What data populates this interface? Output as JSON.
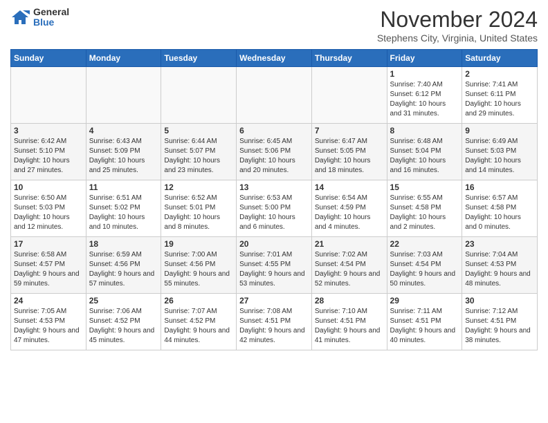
{
  "logo": {
    "general": "General",
    "blue": "Blue"
  },
  "header": {
    "month": "November 2024",
    "location": "Stephens City, Virginia, United States"
  },
  "days_of_week": [
    "Sunday",
    "Monday",
    "Tuesday",
    "Wednesday",
    "Thursday",
    "Friday",
    "Saturday"
  ],
  "weeks": [
    [
      {
        "day": "",
        "empty": true
      },
      {
        "day": "",
        "empty": true
      },
      {
        "day": "",
        "empty": true
      },
      {
        "day": "",
        "empty": true
      },
      {
        "day": "",
        "empty": true
      },
      {
        "day": "1",
        "sunrise": "7:40 AM",
        "sunset": "6:12 PM",
        "daylight": "10 hours and 31 minutes."
      },
      {
        "day": "2",
        "sunrise": "7:41 AM",
        "sunset": "6:11 PM",
        "daylight": "10 hours and 29 minutes."
      }
    ],
    [
      {
        "day": "3",
        "sunrise": "6:42 AM",
        "sunset": "5:10 PM",
        "daylight": "10 hours and 27 minutes."
      },
      {
        "day": "4",
        "sunrise": "6:43 AM",
        "sunset": "5:09 PM",
        "daylight": "10 hours and 25 minutes."
      },
      {
        "day": "5",
        "sunrise": "6:44 AM",
        "sunset": "5:07 PM",
        "daylight": "10 hours and 23 minutes."
      },
      {
        "day": "6",
        "sunrise": "6:45 AM",
        "sunset": "5:06 PM",
        "daylight": "10 hours and 20 minutes."
      },
      {
        "day": "7",
        "sunrise": "6:47 AM",
        "sunset": "5:05 PM",
        "daylight": "10 hours and 18 minutes."
      },
      {
        "day": "8",
        "sunrise": "6:48 AM",
        "sunset": "5:04 PM",
        "daylight": "10 hours and 16 minutes."
      },
      {
        "day": "9",
        "sunrise": "6:49 AM",
        "sunset": "5:03 PM",
        "daylight": "10 hours and 14 minutes."
      }
    ],
    [
      {
        "day": "10",
        "sunrise": "6:50 AM",
        "sunset": "5:03 PM",
        "daylight": "10 hours and 12 minutes."
      },
      {
        "day": "11",
        "sunrise": "6:51 AM",
        "sunset": "5:02 PM",
        "daylight": "10 hours and 10 minutes."
      },
      {
        "day": "12",
        "sunrise": "6:52 AM",
        "sunset": "5:01 PM",
        "daylight": "10 hours and 8 minutes."
      },
      {
        "day": "13",
        "sunrise": "6:53 AM",
        "sunset": "5:00 PM",
        "daylight": "10 hours and 6 minutes."
      },
      {
        "day": "14",
        "sunrise": "6:54 AM",
        "sunset": "4:59 PM",
        "daylight": "10 hours and 4 minutes."
      },
      {
        "day": "15",
        "sunrise": "6:55 AM",
        "sunset": "4:58 PM",
        "daylight": "10 hours and 2 minutes."
      },
      {
        "day": "16",
        "sunrise": "6:57 AM",
        "sunset": "4:58 PM",
        "daylight": "10 hours and 0 minutes."
      }
    ],
    [
      {
        "day": "17",
        "sunrise": "6:58 AM",
        "sunset": "4:57 PM",
        "daylight": "9 hours and 59 minutes."
      },
      {
        "day": "18",
        "sunrise": "6:59 AM",
        "sunset": "4:56 PM",
        "daylight": "9 hours and 57 minutes."
      },
      {
        "day": "19",
        "sunrise": "7:00 AM",
        "sunset": "4:56 PM",
        "daylight": "9 hours and 55 minutes."
      },
      {
        "day": "20",
        "sunrise": "7:01 AM",
        "sunset": "4:55 PM",
        "daylight": "9 hours and 53 minutes."
      },
      {
        "day": "21",
        "sunrise": "7:02 AM",
        "sunset": "4:54 PM",
        "daylight": "9 hours and 52 minutes."
      },
      {
        "day": "22",
        "sunrise": "7:03 AM",
        "sunset": "4:54 PM",
        "daylight": "9 hours and 50 minutes."
      },
      {
        "day": "23",
        "sunrise": "7:04 AM",
        "sunset": "4:53 PM",
        "daylight": "9 hours and 48 minutes."
      }
    ],
    [
      {
        "day": "24",
        "sunrise": "7:05 AM",
        "sunset": "4:53 PM",
        "daylight": "9 hours and 47 minutes."
      },
      {
        "day": "25",
        "sunrise": "7:06 AM",
        "sunset": "4:52 PM",
        "daylight": "9 hours and 45 minutes."
      },
      {
        "day": "26",
        "sunrise": "7:07 AM",
        "sunset": "4:52 PM",
        "daylight": "9 hours and 44 minutes."
      },
      {
        "day": "27",
        "sunrise": "7:08 AM",
        "sunset": "4:51 PM",
        "daylight": "9 hours and 42 minutes."
      },
      {
        "day": "28",
        "sunrise": "7:10 AM",
        "sunset": "4:51 PM",
        "daylight": "9 hours and 41 minutes."
      },
      {
        "day": "29",
        "sunrise": "7:11 AM",
        "sunset": "4:51 PM",
        "daylight": "9 hours and 40 minutes."
      },
      {
        "day": "30",
        "sunrise": "7:12 AM",
        "sunset": "4:51 PM",
        "daylight": "9 hours and 38 minutes."
      }
    ]
  ],
  "labels": {
    "sunrise": "Sunrise:",
    "sunset": "Sunset:",
    "daylight": "Daylight:"
  }
}
